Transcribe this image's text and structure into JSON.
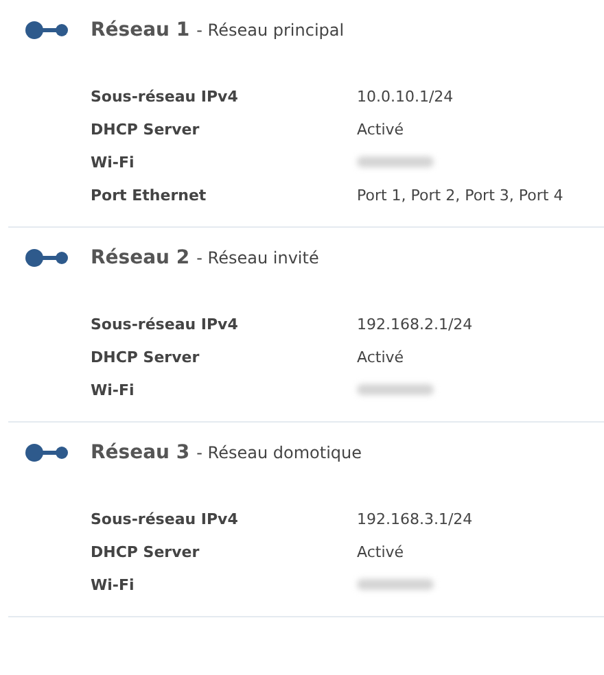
{
  "networks": [
    {
      "name": "Réseau 1",
      "description": "- Réseau principal",
      "rows": [
        {
          "kind": "text",
          "label": "Sous-réseau IPv4",
          "value": "10.0.10.1/24"
        },
        {
          "kind": "text",
          "label": "DHCP Server",
          "value": "Activé"
        },
        {
          "kind": "redacted",
          "label": "Wi-Fi"
        },
        {
          "kind": "text",
          "label": "Port Ethernet",
          "value": "Port 1, Port 2, Port 3, Port 4"
        }
      ]
    },
    {
      "name": "Réseau 2",
      "description": "- Réseau invité",
      "rows": [
        {
          "kind": "text",
          "label": "Sous-réseau IPv4",
          "value": "192.168.2.1/24"
        },
        {
          "kind": "text",
          "label": "DHCP Server",
          "value": "Activé"
        },
        {
          "kind": "redacted",
          "label": "Wi-Fi"
        }
      ]
    },
    {
      "name": "Réseau 3",
      "description": "- Réseau domotique",
      "rows": [
        {
          "kind": "text",
          "label": "Sous-réseau IPv4",
          "value": "192.168.3.1/24"
        },
        {
          "kind": "text",
          "label": "DHCP Server",
          "value": "Activé"
        },
        {
          "kind": "redacted",
          "label": "Wi-Fi"
        }
      ]
    }
  ]
}
